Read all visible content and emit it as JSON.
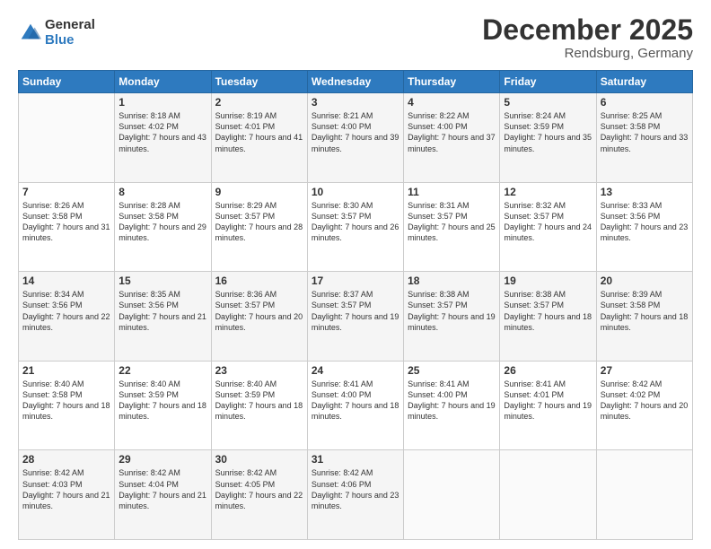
{
  "logo": {
    "general": "General",
    "blue": "Blue"
  },
  "header": {
    "month": "December 2025",
    "location": "Rendsburg, Germany"
  },
  "weekdays": [
    "Sunday",
    "Monday",
    "Tuesday",
    "Wednesday",
    "Thursday",
    "Friday",
    "Saturday"
  ],
  "weeks": [
    [
      {
        "day": "",
        "sunrise": "",
        "sunset": "",
        "daylight": ""
      },
      {
        "day": "1",
        "sunrise": "Sunrise: 8:18 AM",
        "sunset": "Sunset: 4:02 PM",
        "daylight": "Daylight: 7 hours and 43 minutes."
      },
      {
        "day": "2",
        "sunrise": "Sunrise: 8:19 AM",
        "sunset": "Sunset: 4:01 PM",
        "daylight": "Daylight: 7 hours and 41 minutes."
      },
      {
        "day": "3",
        "sunrise": "Sunrise: 8:21 AM",
        "sunset": "Sunset: 4:00 PM",
        "daylight": "Daylight: 7 hours and 39 minutes."
      },
      {
        "day": "4",
        "sunrise": "Sunrise: 8:22 AM",
        "sunset": "Sunset: 4:00 PM",
        "daylight": "Daylight: 7 hours and 37 minutes."
      },
      {
        "day": "5",
        "sunrise": "Sunrise: 8:24 AM",
        "sunset": "Sunset: 3:59 PM",
        "daylight": "Daylight: 7 hours and 35 minutes."
      },
      {
        "day": "6",
        "sunrise": "Sunrise: 8:25 AM",
        "sunset": "Sunset: 3:58 PM",
        "daylight": "Daylight: 7 hours and 33 minutes."
      }
    ],
    [
      {
        "day": "7",
        "sunrise": "Sunrise: 8:26 AM",
        "sunset": "Sunset: 3:58 PM",
        "daylight": "Daylight: 7 hours and 31 minutes."
      },
      {
        "day": "8",
        "sunrise": "Sunrise: 8:28 AM",
        "sunset": "Sunset: 3:58 PM",
        "daylight": "Daylight: 7 hours and 29 minutes."
      },
      {
        "day": "9",
        "sunrise": "Sunrise: 8:29 AM",
        "sunset": "Sunset: 3:57 PM",
        "daylight": "Daylight: 7 hours and 28 minutes."
      },
      {
        "day": "10",
        "sunrise": "Sunrise: 8:30 AM",
        "sunset": "Sunset: 3:57 PM",
        "daylight": "Daylight: 7 hours and 26 minutes."
      },
      {
        "day": "11",
        "sunrise": "Sunrise: 8:31 AM",
        "sunset": "Sunset: 3:57 PM",
        "daylight": "Daylight: 7 hours and 25 minutes."
      },
      {
        "day": "12",
        "sunrise": "Sunrise: 8:32 AM",
        "sunset": "Sunset: 3:57 PM",
        "daylight": "Daylight: 7 hours and 24 minutes."
      },
      {
        "day": "13",
        "sunrise": "Sunrise: 8:33 AM",
        "sunset": "Sunset: 3:56 PM",
        "daylight": "Daylight: 7 hours and 23 minutes."
      }
    ],
    [
      {
        "day": "14",
        "sunrise": "Sunrise: 8:34 AM",
        "sunset": "Sunset: 3:56 PM",
        "daylight": "Daylight: 7 hours and 22 minutes."
      },
      {
        "day": "15",
        "sunrise": "Sunrise: 8:35 AM",
        "sunset": "Sunset: 3:56 PM",
        "daylight": "Daylight: 7 hours and 21 minutes."
      },
      {
        "day": "16",
        "sunrise": "Sunrise: 8:36 AM",
        "sunset": "Sunset: 3:57 PM",
        "daylight": "Daylight: 7 hours and 20 minutes."
      },
      {
        "day": "17",
        "sunrise": "Sunrise: 8:37 AM",
        "sunset": "Sunset: 3:57 PM",
        "daylight": "Daylight: 7 hours and 19 minutes."
      },
      {
        "day": "18",
        "sunrise": "Sunrise: 8:38 AM",
        "sunset": "Sunset: 3:57 PM",
        "daylight": "Daylight: 7 hours and 19 minutes."
      },
      {
        "day": "19",
        "sunrise": "Sunrise: 8:38 AM",
        "sunset": "Sunset: 3:57 PM",
        "daylight": "Daylight: 7 hours and 18 minutes."
      },
      {
        "day": "20",
        "sunrise": "Sunrise: 8:39 AM",
        "sunset": "Sunset: 3:58 PM",
        "daylight": "Daylight: 7 hours and 18 minutes."
      }
    ],
    [
      {
        "day": "21",
        "sunrise": "Sunrise: 8:40 AM",
        "sunset": "Sunset: 3:58 PM",
        "daylight": "Daylight: 7 hours and 18 minutes."
      },
      {
        "day": "22",
        "sunrise": "Sunrise: 8:40 AM",
        "sunset": "Sunset: 3:59 PM",
        "daylight": "Daylight: 7 hours and 18 minutes."
      },
      {
        "day": "23",
        "sunrise": "Sunrise: 8:40 AM",
        "sunset": "Sunset: 3:59 PM",
        "daylight": "Daylight: 7 hours and 18 minutes."
      },
      {
        "day": "24",
        "sunrise": "Sunrise: 8:41 AM",
        "sunset": "Sunset: 4:00 PM",
        "daylight": "Daylight: 7 hours and 18 minutes."
      },
      {
        "day": "25",
        "sunrise": "Sunrise: 8:41 AM",
        "sunset": "Sunset: 4:00 PM",
        "daylight": "Daylight: 7 hours and 19 minutes."
      },
      {
        "day": "26",
        "sunrise": "Sunrise: 8:41 AM",
        "sunset": "Sunset: 4:01 PM",
        "daylight": "Daylight: 7 hours and 19 minutes."
      },
      {
        "day": "27",
        "sunrise": "Sunrise: 8:42 AM",
        "sunset": "Sunset: 4:02 PM",
        "daylight": "Daylight: 7 hours and 20 minutes."
      }
    ],
    [
      {
        "day": "28",
        "sunrise": "Sunrise: 8:42 AM",
        "sunset": "Sunset: 4:03 PM",
        "daylight": "Daylight: 7 hours and 21 minutes."
      },
      {
        "day": "29",
        "sunrise": "Sunrise: 8:42 AM",
        "sunset": "Sunset: 4:04 PM",
        "daylight": "Daylight: 7 hours and 21 minutes."
      },
      {
        "day": "30",
        "sunrise": "Sunrise: 8:42 AM",
        "sunset": "Sunset: 4:05 PM",
        "daylight": "Daylight: 7 hours and 22 minutes."
      },
      {
        "day": "31",
        "sunrise": "Sunrise: 8:42 AM",
        "sunset": "Sunset: 4:06 PM",
        "daylight": "Daylight: 7 hours and 23 minutes."
      },
      {
        "day": "",
        "sunrise": "",
        "sunset": "",
        "daylight": ""
      },
      {
        "day": "",
        "sunrise": "",
        "sunset": "",
        "daylight": ""
      },
      {
        "day": "",
        "sunrise": "",
        "sunset": "",
        "daylight": ""
      }
    ]
  ]
}
